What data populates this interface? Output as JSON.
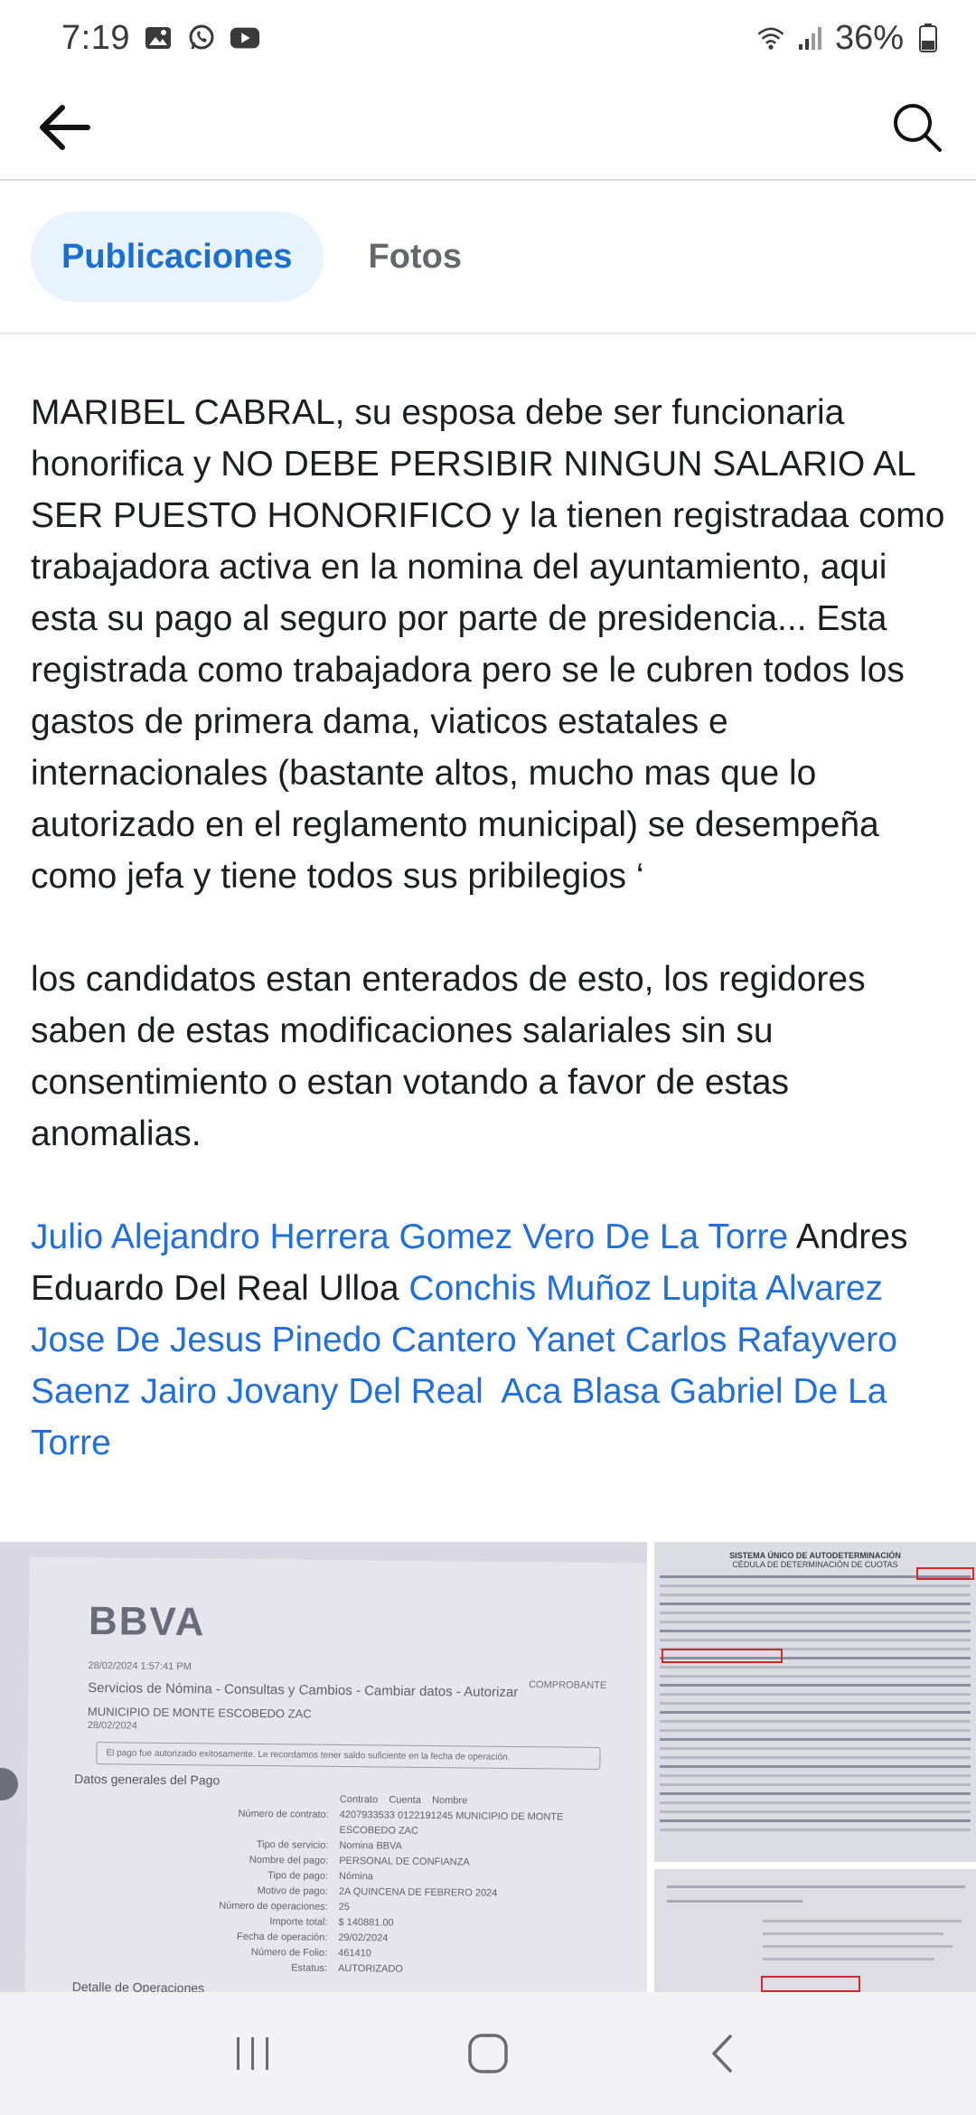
{
  "status_bar": {
    "time": "7:19",
    "battery": "36%",
    "notification_icons": [
      "gallery-icon",
      "whatsapp-icon",
      "youtube-icon"
    ],
    "system_icons": [
      "wifi-icon",
      "signal-icon",
      "battery-icon"
    ]
  },
  "header": {
    "back_icon": "back-arrow-icon",
    "search_icon": "search-icon"
  },
  "tabs": [
    {
      "label": "Publicaciones",
      "active": true
    },
    {
      "label": "Fotos",
      "active": false
    }
  ],
  "post": {
    "paragraph1": "MARIBEL CABRAL, su esposa debe ser funcionaria honorifica y NO DEBE PERSIBIR NINGUN SALARIO AL SER PUESTO HONORIFICO y la tienen registradaa como trabajadora activa en la nomina del ayuntamiento, aqui esta su pago al seguro por parte de presidencia... Esta registrada como trabajadora pero se le cubren todos los gastos de primera dama, viaticos estatales e internacionales (bastante altos, mucho mas que lo autorizado en el reglamento municipal) se desempeña como jefa y tiene todos sus pribilegios ‘",
    "paragraph2": "los candidatos estan enterados de esto, los regidores saben de estas modificaciones salariales sin su consentimiento o estan votando a favor de estas anomalias.",
    "tags": [
      {
        "text": "Julio Alejandro Herrera Gomez",
        "linked": true
      },
      {
        "text": " ",
        "linked": false
      },
      {
        "text": "Vero De La Torre",
        "linked": true
      },
      {
        "text": " Andres Eduardo Del Real Ulloa ",
        "linked": false
      },
      {
        "text": "Conchis Muñoz",
        "linked": true
      },
      {
        "text": " ",
        "linked": false
      },
      {
        "text": "Lupita Alvarez",
        "linked": true
      },
      {
        "text": " ",
        "linked": false
      },
      {
        "text": "Jose De Jesus Pinedo Cantero",
        "linked": true
      },
      {
        "text": " ",
        "linked": false
      },
      {
        "text": "Yanet Carlos",
        "linked": true
      },
      {
        "text": " ",
        "linked": false
      },
      {
        "text": "Rafayvero Saenz",
        "linked": true
      },
      {
        "text": " ",
        "linked": false
      },
      {
        "text": "Jairo Jovany Del Real",
        "linked": true
      },
      {
        "text": "  ",
        "linked": false
      },
      {
        "text": "Aca Blasa",
        "linked": true
      },
      {
        "text": " ",
        "linked": false
      },
      {
        "text": "Gabriel De La Torre",
        "linked": true
      }
    ]
  },
  "photos": {
    "main": {
      "brand": "BBVA",
      "date_line": "28/02/2024 1:57:41 PM",
      "breadcrumb": "Servicios de Nómina - Consultas y Cambios - Cambiar datos - Autorizar",
      "label_right": "COMPROBANTE",
      "org": "MUNICIPIO DE MONTE ESCOBEDO ZAC",
      "org_date": "28/02/2024",
      "notice": "El pago fue autorizado exitosamente. Le recordamos tener saldo suficiente en la fecha de operación.",
      "section": "Datos generales del Pago",
      "col_headers": [
        "Contrato",
        "Cuenta",
        "Nombre"
      ],
      "rows": [
        {
          "k": "Número de contrato:",
          "v": "4207933533  0122191245  MUNICIPIO DE MONTE ESCOBEDO ZAC"
        },
        {
          "k": "Tipo de servicio:",
          "v": "Nomina BBVA"
        },
        {
          "k": "Nombre del pago:",
          "v": "PERSONAL DE CONFIANZA"
        },
        {
          "k": "Tipo de pago:",
          "v": "Nómina"
        },
        {
          "k": "Motivo de pago:",
          "v": "2A QUINCENA DE FEBRERO 2024"
        },
        {
          "k": "Número de operaciones:",
          "v": "25"
        },
        {
          "k": "Importe total:",
          "v": "$ 140881.00"
        },
        {
          "k": "Fecha de operación:",
          "v": "29/02/2024"
        },
        {
          "k": "Número de Folio:",
          "v": "461410"
        },
        {
          "k": "Estatus:",
          "v": "AUTORIZADO"
        }
      ],
      "footer": "Detalle de Operaciones"
    },
    "side1": {
      "title": "SISTEMA ÚNICO DE AUTODETERMINACIÓN",
      "subtitle": "CÉDULA DE DETERMINACIÓN DE CUOTAS"
    }
  },
  "nav_bar": {
    "recent_icon": "recent-apps-icon",
    "home_icon": "home-icon",
    "back_icon": "nav-back-icon"
  }
}
